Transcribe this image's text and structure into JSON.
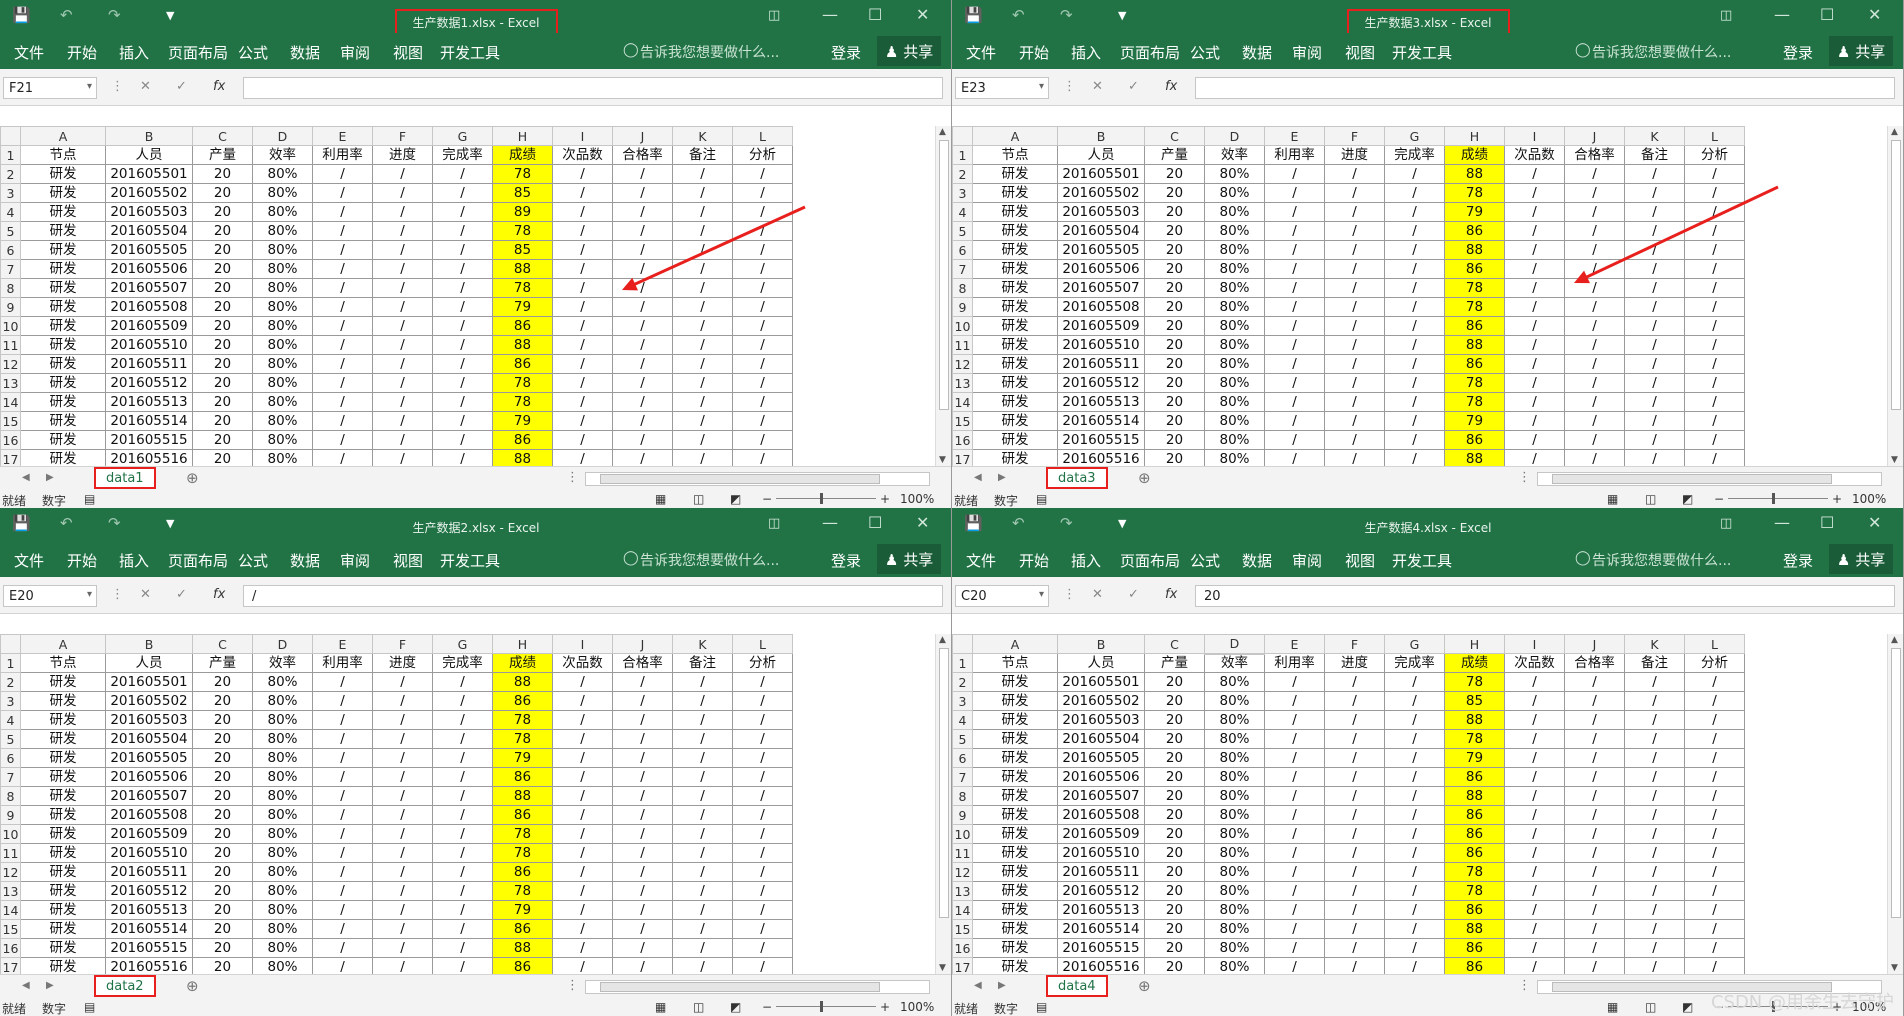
{
  "ribbon_tabs": [
    "文件",
    "开始",
    "插入",
    "页面布局",
    "公式",
    "数据",
    "审阅",
    "视图",
    "开发工具"
  ],
  "tell_me": "告诉我您想要做什么...",
  "signin": "登录",
  "share": "共享",
  "fx_label": "fx",
  "col_headers": [
    "A",
    "B",
    "C",
    "D",
    "E",
    "F",
    "G",
    "H",
    "I",
    "J",
    "K",
    "L"
  ],
  "header_row": [
    "节点",
    "人员",
    "产量",
    "效率",
    "利用率",
    "进度",
    "完成率",
    "成绩",
    "次品数",
    "合格率",
    "备注",
    "分析"
  ],
  "row_node": "研发",
  "row_output": "20",
  "row_efficiency": "80%",
  "placeholder_cell": "/",
  "personnel_ids": [
    "201605501",
    "201605502",
    "201605503",
    "201605504",
    "201605505",
    "201605506",
    "201605507",
    "201605508",
    "201605509",
    "201605510",
    "201605511",
    "201605512",
    "201605513",
    "201605514",
    "201605515",
    "201605516"
  ],
  "status_ready": "就绪",
  "status_digits": "数字",
  "zoom": "100%",
  "watermark": "CSDN @用余生去守护",
  "windows": [
    {
      "title": "生产数据1.xlsx - Excel",
      "name_box": "F21",
      "formula": "",
      "sheet": "data1",
      "scores": [
        "78",
        "85",
        "89",
        "78",
        "85",
        "88",
        "78",
        "79",
        "86",
        "88",
        "86",
        "78",
        "78",
        "79",
        "86",
        "88"
      ]
    },
    {
      "title": "生产数据3.xlsx - Excel",
      "name_box": "E23",
      "formula": "",
      "sheet": "data3",
      "scores": [
        "88",
        "78",
        "79",
        "86",
        "88",
        "86",
        "78",
        "78",
        "86",
        "88",
        "86",
        "78",
        "78",
        "79",
        "86",
        "88"
      ]
    },
    {
      "title": "生产数据2.xlsx - Excel",
      "name_box": "E20",
      "formula": "/",
      "sheet": "data2",
      "scores": [
        "88",
        "86",
        "78",
        "78",
        "79",
        "86",
        "88",
        "86",
        "78",
        "78",
        "86",
        "78",
        "79",
        "86",
        "88",
        "86"
      ]
    },
    {
      "title": "生产数据4.xlsx - Excel",
      "name_box": "C20",
      "formula": "20",
      "sheet": "data4",
      "scores": [
        "78",
        "85",
        "88",
        "78",
        "79",
        "86",
        "88",
        "86",
        "86",
        "86",
        "78",
        "78",
        "86",
        "88",
        "86",
        "86"
      ]
    }
  ],
  "colors": {
    "excel_green": "#217346",
    "highlight": "#ffff00",
    "annotation_red": "#e8201d"
  },
  "icons": [
    "save-icon",
    "undo-icon",
    "redo-icon",
    "customize-icon",
    "lightbulb-icon",
    "user-icon",
    "restore-icon",
    "minimize-icon",
    "maximize-icon",
    "close-icon",
    "cancel-icon",
    "enter-icon",
    "new-sheet-icon",
    "normal-view-icon",
    "page-layout-view-icon",
    "page-break-view-icon"
  ]
}
